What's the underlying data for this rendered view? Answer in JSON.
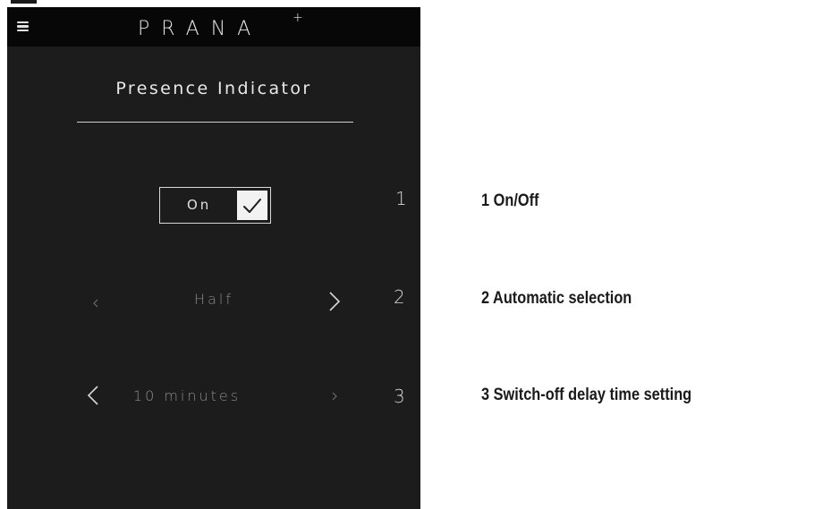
{
  "header": {
    "brand": "PRANA",
    "brand_superscript": "+",
    "menu_icon": "hamburger-menu-icon"
  },
  "page": {
    "title": "Presence Indicator"
  },
  "toggle": {
    "label": "On",
    "checked": true,
    "icon": "checkmark-icon"
  },
  "selectors": [
    {
      "value": "Half",
      "left_icon": "chevron-left-icon",
      "right_icon": "chevron-right-icon"
    },
    {
      "value": "10 minutes",
      "left_icon": "chevron-left-icon",
      "right_icon": "chevron-right-icon"
    }
  ],
  "row_numbers": [
    "1",
    "2",
    "3"
  ],
  "legend": [
    "1 On/Off",
    "2 Automatic selection",
    "3 Switch-off delay time setting"
  ],
  "colors": {
    "screen_background": "#1c1c1c",
    "topbar_background": "#070707",
    "text_light": "#e8e8e8",
    "text_dim": "#8a8a8a",
    "legend_text": "#1a1a1a"
  }
}
